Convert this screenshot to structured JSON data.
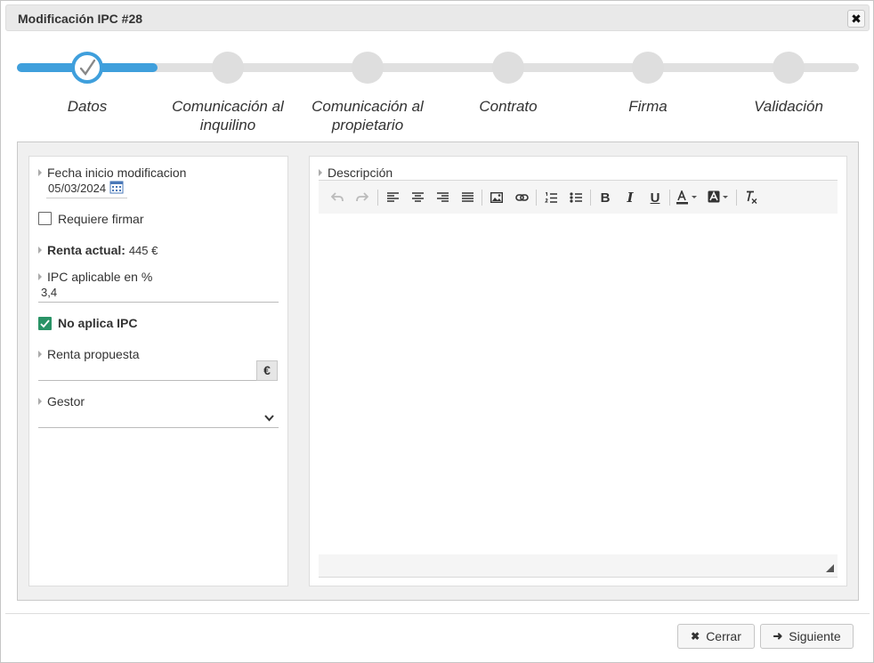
{
  "dialog": {
    "title": "Modificación IPC #28",
    "close_symbol": "✖"
  },
  "stepper": {
    "progress_percent": 16.7,
    "steps": [
      {
        "label": "Datos",
        "status": "done"
      },
      {
        "label": "Comunicación al inquilino",
        "status": "pending"
      },
      {
        "label": "Comunicación al propietario",
        "status": "pending"
      },
      {
        "label": "Contrato",
        "status": "pending"
      },
      {
        "label": "Firma",
        "status": "pending"
      },
      {
        "label": "Validación",
        "status": "pending"
      }
    ]
  },
  "form": {
    "fecha_label": "Fecha inicio modificacion",
    "fecha_value": "05/03/2024",
    "requiere_firmar_label": "Requiere firmar",
    "requiere_firmar_checked": false,
    "renta_actual_label": "Renta actual:",
    "renta_actual_value": "445 €",
    "ipc_label": "IPC aplicable en %",
    "ipc_value": "3,4",
    "no_aplica_label": "No aplica IPC",
    "no_aplica_checked": true,
    "renta_propuesta_label": "Renta propuesta",
    "renta_propuesta_value": "",
    "currency_symbol": "€",
    "gestor_label": "Gestor",
    "gestor_value": ""
  },
  "editor": {
    "label": "Descripción",
    "content": "",
    "toolbar_icons": [
      "undo-icon",
      "redo-icon",
      "align-left-icon",
      "align-center-icon",
      "align-right-icon",
      "align-justify-icon",
      "image-icon",
      "link-icon",
      "ordered-list-icon",
      "unordered-list-icon",
      "bold-icon",
      "italic-icon",
      "underline-icon",
      "text-color-icon",
      "background-color-icon",
      "clear-format-icon"
    ]
  },
  "footer": {
    "close_label": "Cerrar",
    "next_label": "Siguiente"
  },
  "colors": {
    "accent": "#3f9fdc",
    "check_green": "#2a9366"
  }
}
